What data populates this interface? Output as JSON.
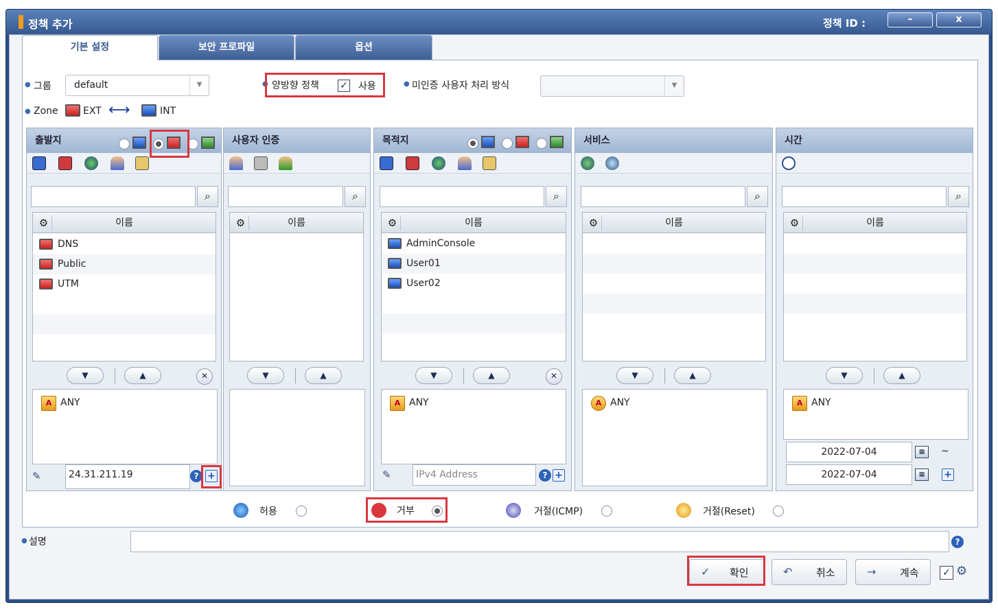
{
  "window": {
    "title": "정책 추가",
    "policy_id_label": "정책 ID :",
    "minimize": "–",
    "close": "x"
  },
  "tabs": [
    "기본 설정",
    "보안 프로파일",
    "옵션"
  ],
  "top": {
    "group_label": "그룹",
    "group_value": "default",
    "bidirectional_label": "양방향 정책",
    "bidirectional_use": "사용",
    "unauth_label": "미인증 사용자 처리 방식",
    "unauth_value": "",
    "zone_label": "Zone",
    "zone_from": "EXT",
    "zone_to": "INT"
  },
  "panels": {
    "source": {
      "title": "출발지",
      "list_header": "이름",
      "items": [
        "DNS",
        "Public",
        "UTM"
      ],
      "selected": "ANY",
      "address_value": "24.31.211.19"
    },
    "user_auth": {
      "title": "사용자 인증",
      "list_header": "이름"
    },
    "destination": {
      "title": "목적지",
      "list_header": "이름",
      "items": [
        "AdminConsole",
        "User01",
        "User02"
      ],
      "selected": "ANY",
      "address_placeholder": "IPv4 Address"
    },
    "service": {
      "title": "서비스",
      "list_header": "이름",
      "selected": "ANY"
    },
    "time": {
      "title": "시간",
      "list_header": "이름",
      "selected": "ANY",
      "date_from": "2022-07-04",
      "date_to": "2022-07-04",
      "tilde": "~"
    }
  },
  "actions": {
    "allow": "허용",
    "deny": "거부",
    "reject_icmp": "거절(ICMP)",
    "reject_reset": "거절(Reset)",
    "selected": "거부"
  },
  "description": {
    "label": "설명",
    "value": ""
  },
  "buttons": {
    "ok": "확인",
    "cancel": "취소",
    "continue": "계속"
  },
  "colors": {
    "highlight": "#d9363e",
    "title_bar": "#35598f"
  }
}
